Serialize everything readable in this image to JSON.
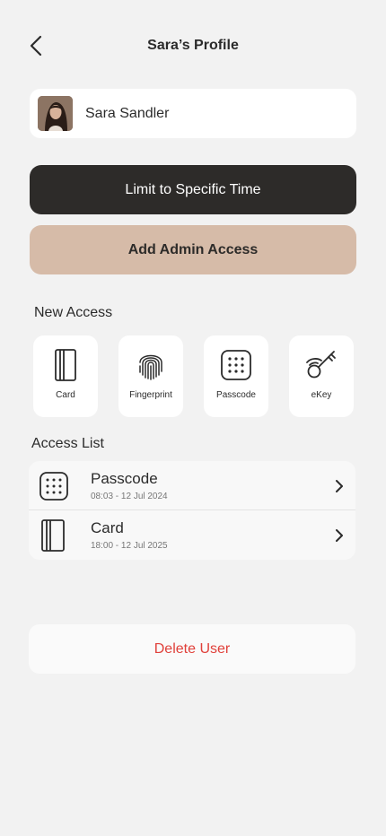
{
  "header": {
    "title": "Sara’s Profile",
    "back_icon": "chevron-left-icon"
  },
  "user": {
    "name": "Sara Sandler",
    "avatar_icon": "avatar"
  },
  "buttons": {
    "limit_time": "Limit to Specific Time",
    "add_admin": "Add Admin Access"
  },
  "new_access": {
    "label": "New Access",
    "items": [
      {
        "label": "Card",
        "icon": "card-icon"
      },
      {
        "label": "Fingerprint",
        "icon": "fingerprint-icon"
      },
      {
        "label": "Passcode",
        "icon": "passcode-icon"
      },
      {
        "label": "eKey",
        "icon": "ekey-icon"
      }
    ]
  },
  "access_list": {
    "label": "Access List",
    "items": [
      {
        "title": "Passcode",
        "subtitle": "08:03 - 12 Jul 2024",
        "icon": "passcode-icon"
      },
      {
        "title": "Card",
        "subtitle": "18:00 - 12 Jul 2025",
        "icon": "card-icon"
      }
    ]
  },
  "delete": {
    "label": "Delete User"
  },
  "colors": {
    "background": "#f2f2f2",
    "dark_button": "#2d2b29",
    "tan_button": "#d6bba8",
    "danger": "#e0403a"
  }
}
